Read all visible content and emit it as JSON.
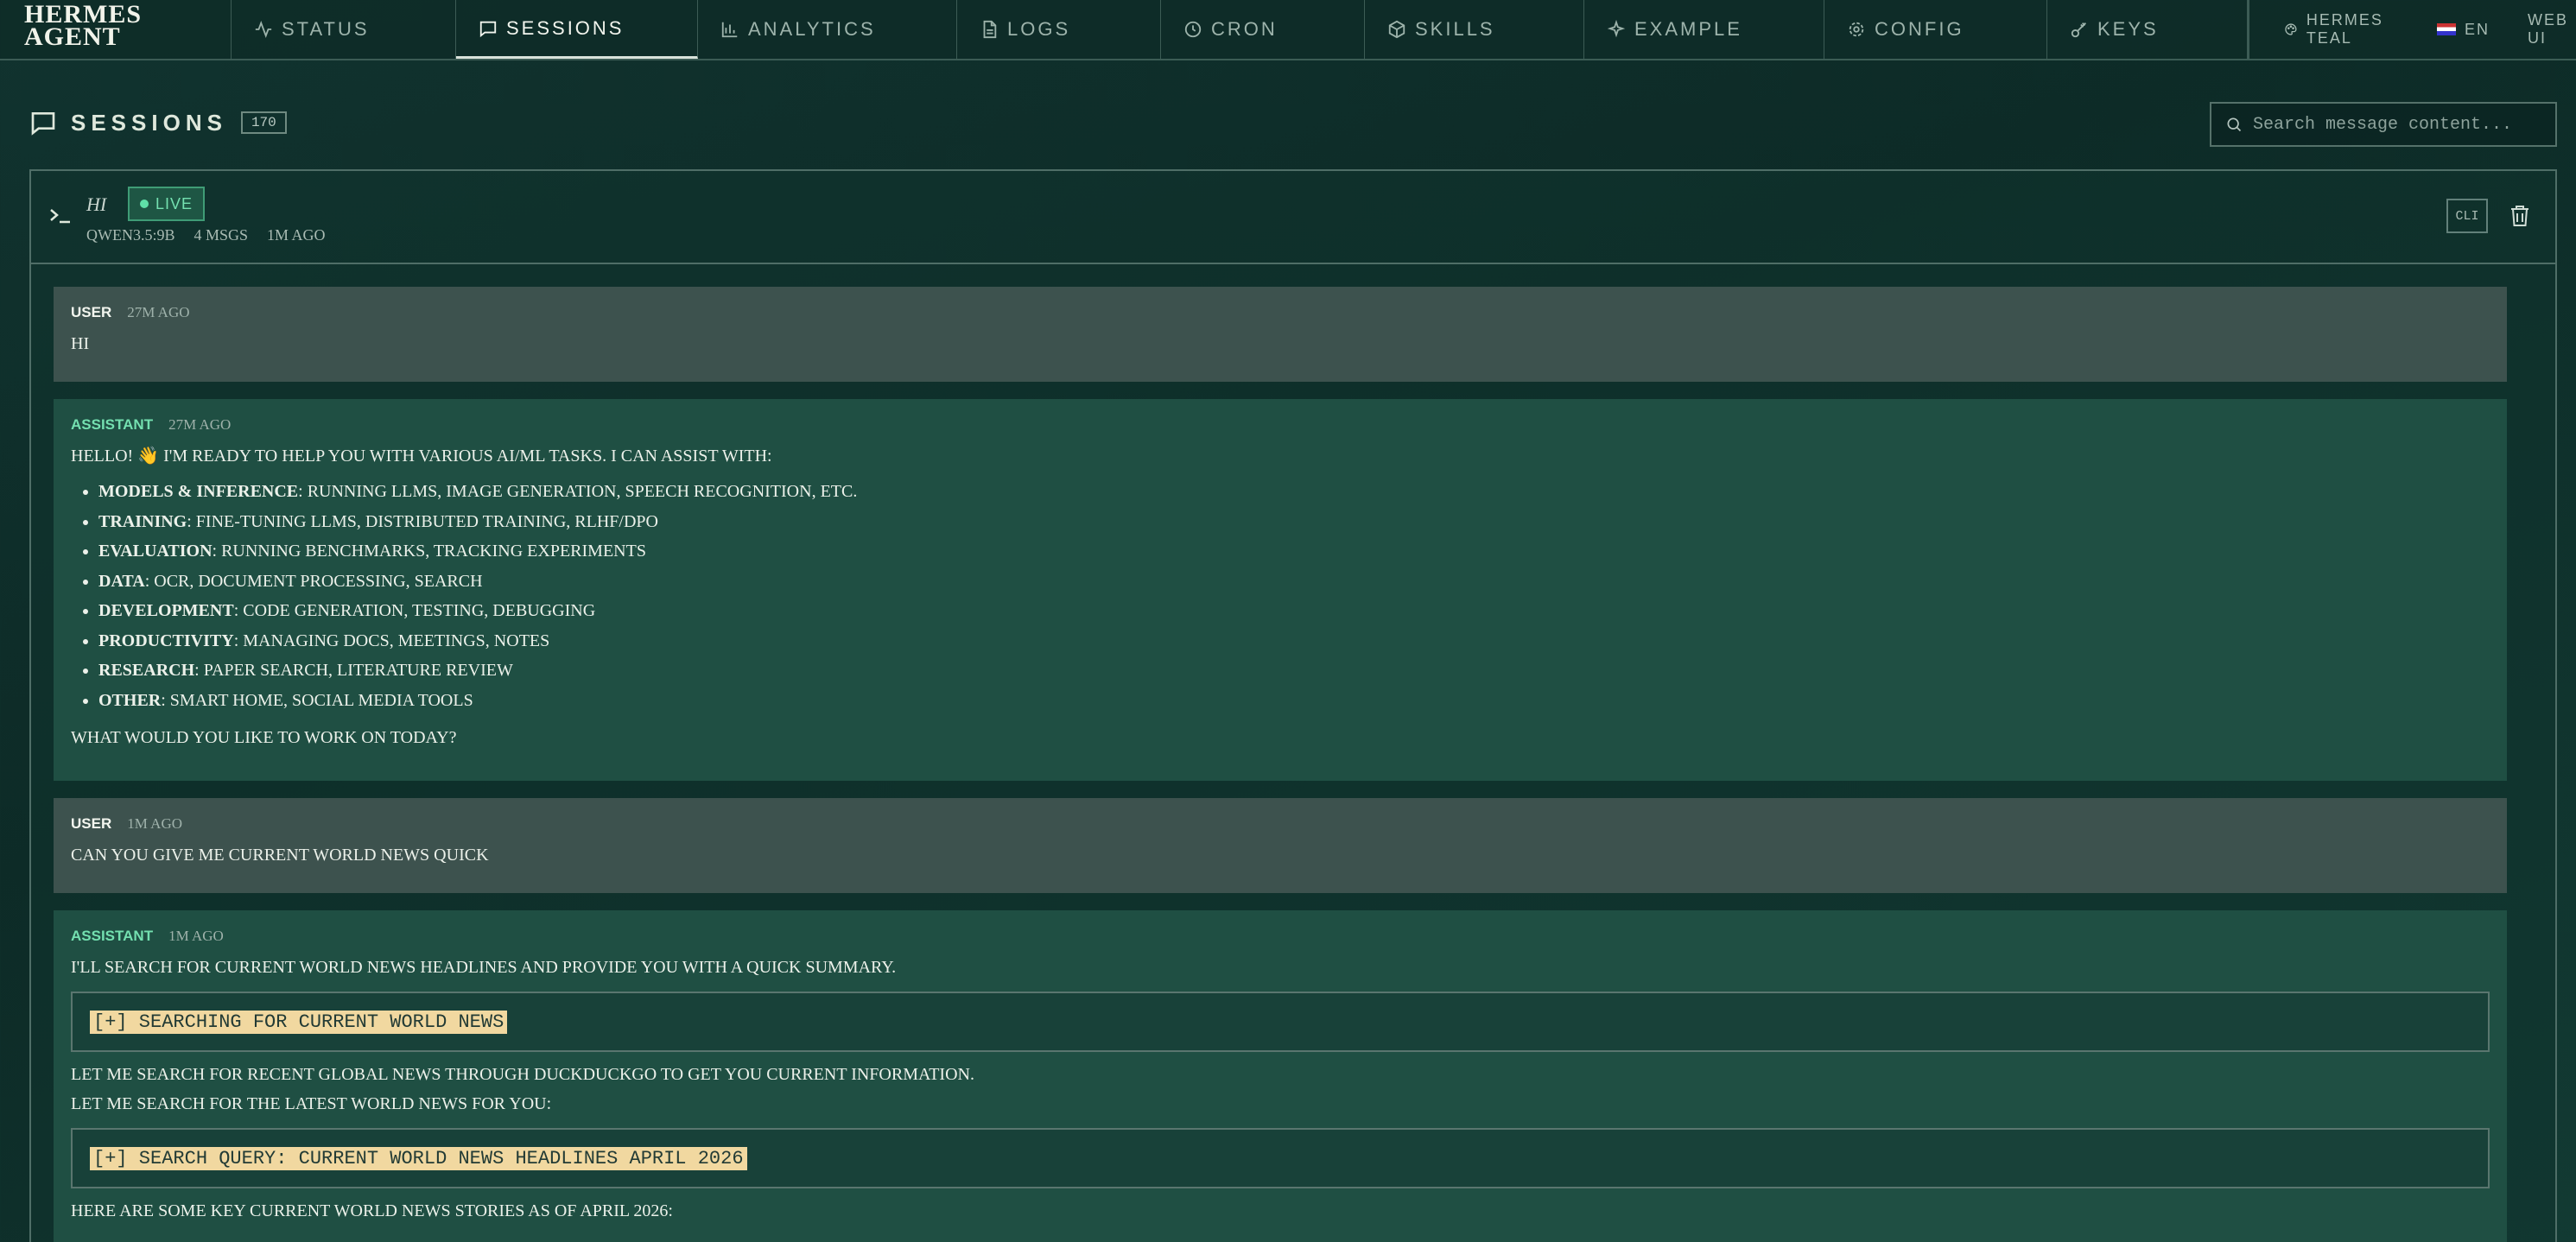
{
  "brand": {
    "line1": "HERMES",
    "line2": "AGENT"
  },
  "nav": {
    "tabs": [
      {
        "label": "STATUS",
        "icon": "activity-icon"
      },
      {
        "label": "SESSIONS",
        "icon": "chat-icon",
        "active": true
      },
      {
        "label": "ANALYTICS",
        "icon": "bar-chart-icon"
      },
      {
        "label": "LOGS",
        "icon": "file-icon"
      },
      {
        "label": "CRON",
        "icon": "clock-icon"
      },
      {
        "label": "SKILLS",
        "icon": "package-icon"
      },
      {
        "label": "EXAMPLE",
        "icon": "sparkle-icon"
      },
      {
        "label": "CONFIG",
        "icon": "gear-icon"
      },
      {
        "label": "KEYS",
        "icon": "key-icon"
      }
    ],
    "theme_label": "HERMES TEAL",
    "language_label": "EN",
    "webui_label": "WEB UI"
  },
  "page": {
    "title": "SESSIONS",
    "count": "170",
    "search_placeholder": "Search message content..."
  },
  "session": {
    "title": "HI",
    "live_label": "LIVE",
    "model": "QWEN3.5:9B",
    "msgs": "4 MSGS",
    "age": "1M AGO",
    "source_label": "CLI"
  },
  "messages": [
    {
      "role": "USER",
      "time": "27M AGO",
      "text": "HI"
    },
    {
      "role": "ASSISTANT",
      "time": "27M AGO",
      "intro": "HELLO! 👋 I'M READY TO HELP YOU WITH VARIOUS AI/ML TASKS. I CAN ASSIST WITH:",
      "items": [
        {
          "bold": "MODELS & INFERENCE",
          "rest": ": RUNNING LLMS, IMAGE GENERATION, SPEECH RECOGNITION, ETC."
        },
        {
          "bold": "TRAINING",
          "rest": ": FINE-TUNING LLMS, DISTRIBUTED TRAINING, RLHF/DPO"
        },
        {
          "bold": "EVALUATION",
          "rest": ": RUNNING BENCHMARKS, TRACKING EXPERIMENTS"
        },
        {
          "bold": "DATA",
          "rest": ": OCR, DOCUMENT PROCESSING, SEARCH"
        },
        {
          "bold": "DEVELOPMENT",
          "rest": ": CODE GENERATION, TESTING, DEBUGGING"
        },
        {
          "bold": "PRODUCTIVITY",
          "rest": ": MANAGING DOCS, MEETINGS, NOTES"
        },
        {
          "bold": "RESEARCH",
          "rest": ": PAPER SEARCH, LITERATURE REVIEW"
        },
        {
          "bold": "OTHER",
          "rest": ": SMART HOME, SOCIAL MEDIA TOOLS"
        }
      ],
      "outro": "WHAT WOULD YOU LIKE TO WORK ON TODAY?"
    },
    {
      "role": "USER",
      "time": "1M AGO",
      "text": "CAN YOU GIVE ME CURRENT WORLD NEWS QUICK"
    },
    {
      "role": "ASSISTANT",
      "time": "1M AGO",
      "line1": "I'LL SEARCH FOR CURRENT WORLD NEWS HEADLINES AND PROVIDE YOU WITH A QUICK SUMMARY.",
      "tool1": "[+] SEARCHING FOR CURRENT WORLD NEWS",
      "line2": "LET ME SEARCH FOR RECENT GLOBAL NEWS THROUGH DUCKDUCKGO TO GET YOU CURRENT INFORMATION.",
      "line3": "LET ME SEARCH FOR THE LATEST WORLD NEWS FOR YOU:",
      "tool2": "[+] SEARCH QUERY: CURRENT WORLD NEWS HEADLINES APRIL 2026",
      "line4": "HERE ARE SOME KEY CURRENT WORLD NEWS STORIES AS OF APRIL 2026:"
    }
  ]
}
